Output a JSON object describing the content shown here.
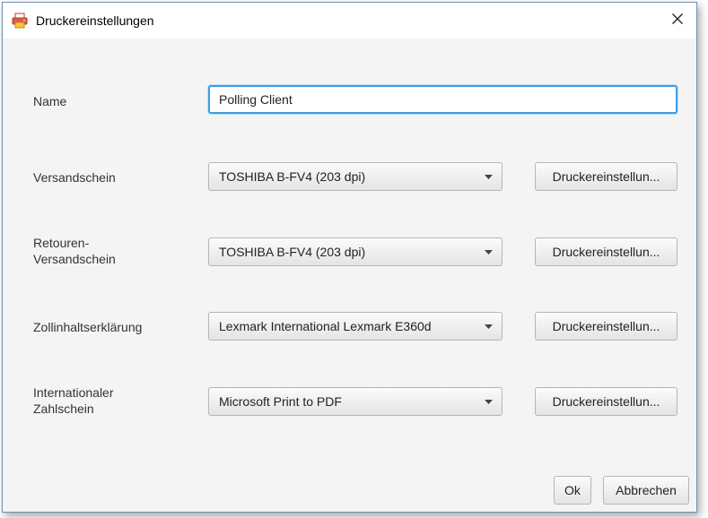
{
  "window": {
    "title": "Druckereinstellungen",
    "icon": "printer-app-icon",
    "close_icon": "close-icon"
  },
  "form": {
    "name": {
      "label": "Name",
      "value": "Polling Client"
    },
    "rows": [
      {
        "label_line1": "Versandschein",
        "label_line2": "",
        "selected": "TOSHIBA B-FV4 (203 dpi)",
        "button": "Druckereinstellun..."
      },
      {
        "label_line1": "Retouren-",
        "label_line2": "Versandschein",
        "selected": "TOSHIBA B-FV4 (203 dpi)",
        "button": "Druckereinstellun..."
      },
      {
        "label_line1": "Zollinhaltserklärung",
        "label_line2": "",
        "selected": "Lexmark International Lexmark E360d",
        "button": "Druckereinstellun..."
      },
      {
        "label_line1": "Internationaler",
        "label_line2": "Zahlschein",
        "selected": "Microsoft Print to PDF",
        "button": "Druckereinstellun..."
      }
    ]
  },
  "footer": {
    "ok_label": "Ok",
    "cancel_label": "Abbrechen"
  },
  "colors": {
    "focus_border": "#3e9ee0",
    "background": "#f4f4f4"
  }
}
